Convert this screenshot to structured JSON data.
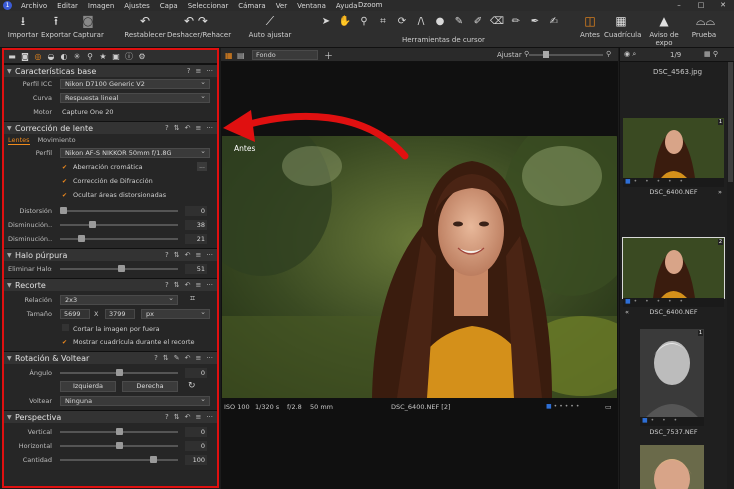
{
  "menubar": {
    "app_icon": "1",
    "items": [
      "Archivo",
      "Editar",
      "Imagen",
      "Ajustes",
      "Capa",
      "Seleccionar",
      "Cámara",
      "Ver",
      "Ventana",
      "Ayuda"
    ],
    "window_title": "Dzoom",
    "controls": [
      "–",
      "□",
      "✕"
    ]
  },
  "toolbar": {
    "importar": "Importar",
    "exportar": "Exportar",
    "capturar": "Capturar",
    "restablecer": "Restablecer",
    "deshacer": "Deshacer/Rehacer",
    "auto_ajustar": "Auto ajustar",
    "cursor_tools_label": "Herramientas de cursor",
    "antes": "Antes",
    "cuadricula": "Cuadrícula",
    "aviso_expo": "Aviso de expo",
    "prueba": "Prueba"
  },
  "colors": {
    "accent": "#f08a1c",
    "highlight_border": "#e01010",
    "arrow": "#e01010",
    "selection_blue": "#2e6fd6"
  },
  "panel": {
    "caracteristicas": {
      "title": "Características base",
      "perfil_label": "Perfil ICC",
      "perfil_value": "Nikon D7100 Generic V2",
      "curva_label": "Curva",
      "curva_value": "Respuesta lineal",
      "motor_label": "Motor",
      "motor_value": "Capture One 20"
    },
    "lente": {
      "title": "Corrección de lente",
      "tab_lentes": "Lentes",
      "tab_movimiento": "Movimiento",
      "perfil_label": "Perfil",
      "perfil_value": "Nikon AF-S NIKKOR 50mm f/1.8G",
      "more_button": "...",
      "check1": "Aberración cromática",
      "check2": "Corrección de Difracción",
      "check3": "Ocultar áreas distorsionadas",
      "distorsion_label": "Distorsión",
      "distorsion_value": "0",
      "dism1_label": "Disminución...",
      "dism1_value": "38",
      "dism2_label": "Disminución...",
      "dism2_value": "21"
    },
    "halo": {
      "title": "Halo púrpura",
      "eliminar_label": "Eliminar Halos",
      "eliminar_value": "51"
    },
    "recorte": {
      "title": "Recorte",
      "relacion_label": "Relación",
      "relacion_value": "2x3",
      "tamano_label": "Tamaño",
      "width": "5699",
      "x": "X",
      "height": "3799",
      "unit": "px",
      "check1": "Cortar la imagen por fuera",
      "check2": "Mostrar cuadrícula durante el recorte"
    },
    "rotacion": {
      "title": "Rotación & Voltear",
      "angulo_label": "Ángulo",
      "angulo_value": "0",
      "izquierda": "Izquierda",
      "derecha": "Derecha",
      "voltear_label": "Voltear",
      "voltear_value": "Ninguna"
    },
    "perspectiva": {
      "title": "Perspectiva",
      "vertical_label": "Vertical",
      "vertical_value": "0",
      "horizontal_label": "Horizontal",
      "horizontal_value": "0",
      "cantidad_label": "Cantidad",
      "cantidad_value": "100"
    }
  },
  "viewer": {
    "background_select": "Fondo",
    "ajustar": "Ajustar",
    "photo_label": "Antes",
    "status": {
      "iso": "ISO 100",
      "shutter": "1/320 s",
      "aperture": "f/2.8",
      "focal": "50 mm",
      "file": "DSC_6400.NEF [2]"
    }
  },
  "browser": {
    "count": "1/9",
    "top_file": "DSC_4563.jpg",
    "thumbs": [
      {
        "name": "DSC_6400.NEF",
        "badge": "1",
        "left_mark": "",
        "right_mark": "»"
      },
      {
        "name": "DSC_6400.NEF",
        "badge": "2",
        "left_mark": "«",
        "right_mark": ""
      },
      {
        "name": "DSC_7537.NEF",
        "badge": "1",
        "left_mark": "",
        "right_mark": ""
      }
    ]
  }
}
